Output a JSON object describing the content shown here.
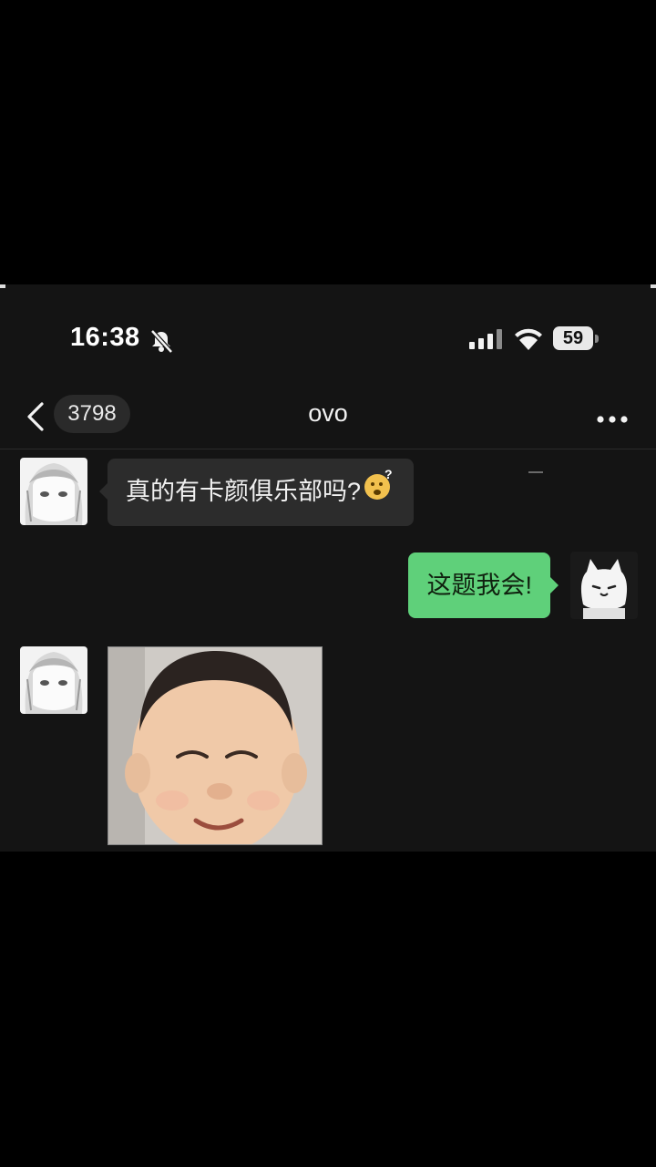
{
  "status_bar": {
    "time": "16:38",
    "battery": "59"
  },
  "nav": {
    "unread_count": "3798",
    "title": "ovo"
  },
  "messages": [
    {
      "side": "left",
      "type": "text",
      "text": "真的有卡颜俱乐部吗?"
    },
    {
      "side": "right",
      "type": "text",
      "text": "这题我会!"
    },
    {
      "side": "left",
      "type": "image"
    }
  ],
  "colors": {
    "background": "#141414",
    "incoming_bubble": "#2c2c2c",
    "outgoing_bubble": "#5fd07a"
  },
  "icons": [
    "bell-slash-icon",
    "signal-icon",
    "wifi-icon",
    "battery-icon",
    "back-icon",
    "more-icon",
    "thinking-emoji-icon"
  ]
}
